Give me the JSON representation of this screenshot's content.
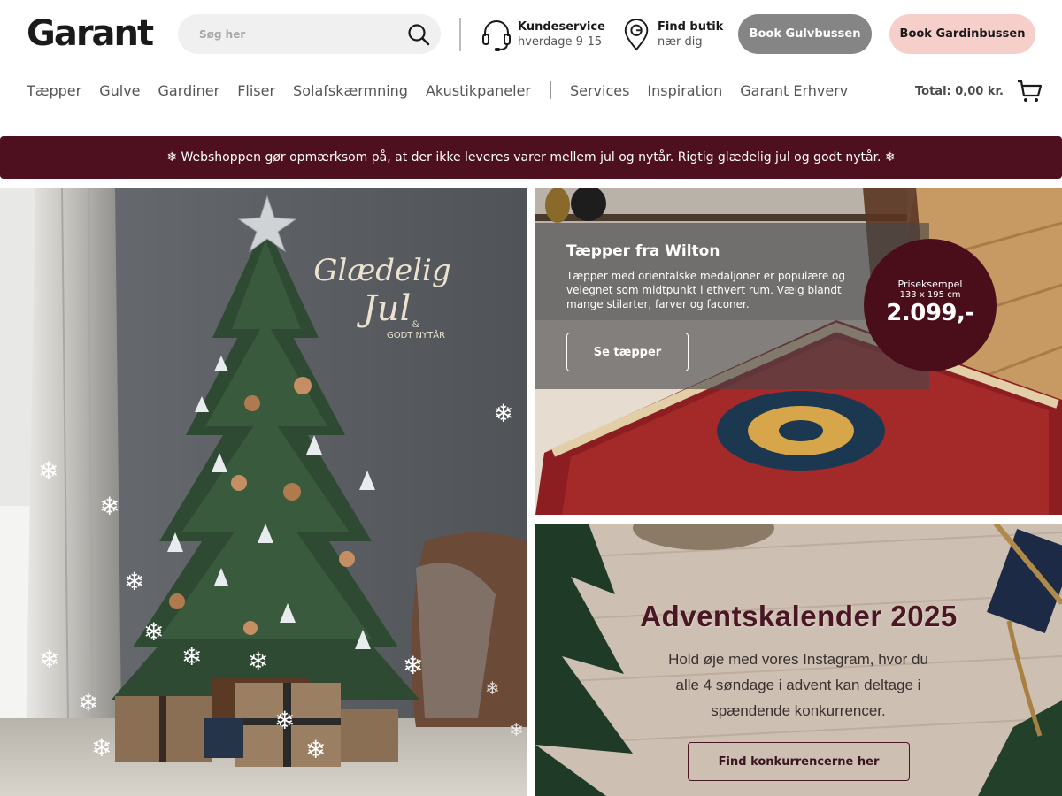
{
  "brand": {
    "logo_text": "Garant"
  },
  "search": {
    "placeholder": "Søg her"
  },
  "header": {
    "kundeservice": {
      "title": "Kundeservice",
      "subtitle": "hverdage 9-15"
    },
    "find_butik": {
      "title": "Find butik",
      "subtitle": "nær dig"
    },
    "book_gulvbussen": "Book Gulvbussen",
    "book_gardinbussen": "Book Gardinbussen"
  },
  "nav": {
    "items": [
      "Tæpper",
      "Gulve",
      "Gardiner",
      "Fliser",
      "Solafskærmning",
      "Akustikpaneler"
    ],
    "secondary": [
      "Services",
      "Inspiration",
      "Garant Erhverv"
    ]
  },
  "cart": {
    "total": "Total: 0,00 kr."
  },
  "notice": {
    "text": "❄ Webshoppen gør opmærksom på, at der ikke leveres varer mellem jul og nytår. Rigtig glædelig jul og godt nytår. ❄"
  },
  "hero": {
    "greeting_line1": "Glædelig",
    "greeting_line2": "Jul",
    "greeting_amp": "&",
    "greeting_line3": "GODT NYTÅR"
  },
  "wilton": {
    "title": "Tæpper fra Wilton",
    "description": "Tæpper med orientalske medaljoner er populære og velegnet som midtpunkt i ethvert rum. Vælg blandt mange stilarter, farver og faconer.",
    "button": "Se tæpper",
    "price_label": "Priseksempel",
    "price_size": "133 x 195 cm",
    "price_value": "2.099,-"
  },
  "advent": {
    "title": "Adventskalender 2025",
    "text": "Hold øje med vores Instagram, hvor du alle 4 søndage i advent kan deltage i spændende konkurrencer.",
    "button": "Find konkurrencerne her"
  },
  "colors": {
    "brand_dark": "#4e0f1e",
    "gulv_pill": "#858585",
    "gardin_pill": "#f6cfcb",
    "search_bg": "#f0f0f0"
  }
}
